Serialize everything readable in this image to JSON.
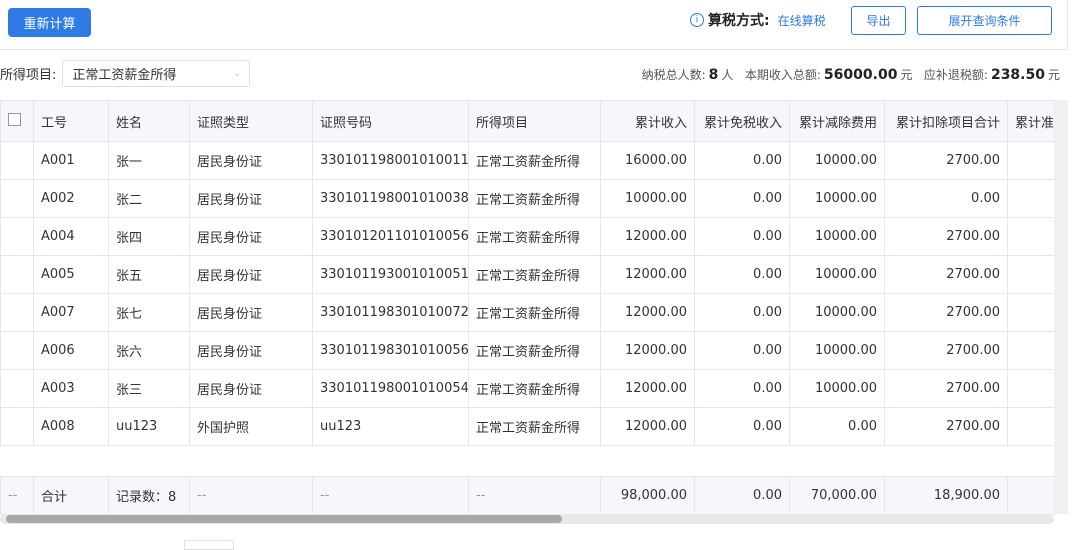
{
  "toolbar": {
    "recalc": "重新计算",
    "method_label": "算税方式:",
    "method_value": "在线算税",
    "export": "导出",
    "expand": "展开查询条件"
  },
  "filter": {
    "label": "所得项目:",
    "value": "正常工资薪金所得"
  },
  "stats": {
    "people_label": "纳税总人数:",
    "people": "8",
    "people_unit": "人",
    "income_label": "本期收入总额:",
    "income": "56000.00",
    "income_unit": "元",
    "tax_label": "应补退税额:",
    "tax": "238.50",
    "tax_unit": "元"
  },
  "columns": [
    "",
    "工号",
    "姓名",
    "证照类型",
    "证照号码",
    "所得项目",
    "累计收入",
    "累计免税收入",
    "累计减除费用",
    "累计扣除项目合计",
    "累计准"
  ],
  "rows": [
    [
      "A001",
      "张一",
      "居民身份证",
      "330101198001010011",
      "正常工资薪金所得",
      "16000.00",
      "0.00",
      "10000.00",
      "2700.00"
    ],
    [
      "A002",
      "张二",
      "居民身份证",
      "330101198001010038",
      "正常工资薪金所得",
      "10000.00",
      "0.00",
      "10000.00",
      "0.00"
    ],
    [
      "A004",
      "张四",
      "居民身份证",
      "330101201101010056",
      "正常工资薪金所得",
      "12000.00",
      "0.00",
      "10000.00",
      "2700.00"
    ],
    [
      "A005",
      "张五",
      "居民身份证",
      "330101193001010051",
      "正常工资薪金所得",
      "12000.00",
      "0.00",
      "10000.00",
      "2700.00"
    ],
    [
      "A007",
      "张七",
      "居民身份证",
      "330101198301010072",
      "正常工资薪金所得",
      "12000.00",
      "0.00",
      "10000.00",
      "2700.00"
    ],
    [
      "A006",
      "张六",
      "居民身份证",
      "330101198301010056",
      "正常工资薪金所得",
      "12000.00",
      "0.00",
      "10000.00",
      "2700.00"
    ],
    [
      "A003",
      "张三",
      "居民身份证",
      "330101198001010054",
      "正常工资薪金所得",
      "12000.00",
      "0.00",
      "10000.00",
      "2700.00"
    ],
    [
      "A008",
      "uu123",
      "外国护照",
      "uu123",
      "正常工资薪金所得",
      "12000.00",
      "0.00",
      "0.00",
      "2700.00"
    ]
  ],
  "footer": [
    "--",
    "合计",
    "记录数：8",
    "--",
    "--",
    "--",
    "98,000.00",
    "0.00",
    "70,000.00",
    "18,900.00",
    ""
  ]
}
